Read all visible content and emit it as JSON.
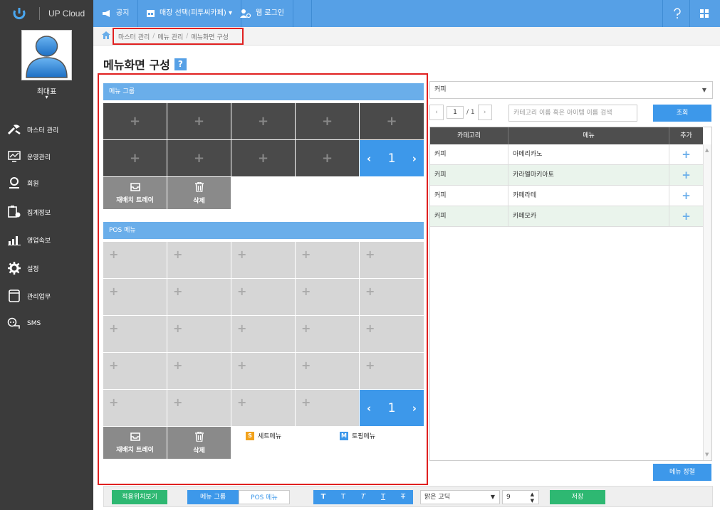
{
  "app": {
    "name": "UP Cloud"
  },
  "topnav": {
    "notice": "공지",
    "store_select": "매장 선택(피투씨카페) ▾",
    "login": "웹 로그인",
    "help_icon": "question-icon",
    "grid_icon": "grid-icon"
  },
  "user": {
    "name": "최대표",
    "caret": "▾"
  },
  "sidebar": {
    "items": [
      {
        "label": "마스터 관리",
        "icon": "tools-icon"
      },
      {
        "label": "운영관리",
        "icon": "chart-monitor-icon"
      },
      {
        "label": "회원",
        "icon": "user-icon"
      },
      {
        "label": "집계정보",
        "icon": "clipboard-icon"
      },
      {
        "label": "영업속보",
        "icon": "bar-chart-icon"
      },
      {
        "label": "설정",
        "icon": "gear-icon"
      },
      {
        "label": "관리업무",
        "icon": "notebook-icon"
      },
      {
        "label": "SMS",
        "icon": "sms-icon"
      }
    ]
  },
  "breadcrumb": {
    "items": [
      "마스터 관리",
      "메뉴 관리",
      "메뉴화면 구성"
    ],
    "sep": "/"
  },
  "page": {
    "title": "메뉴화면 구성",
    "help": "?"
  },
  "menu_group": {
    "header": "메뉴 그룹",
    "plus": "+",
    "page": "1",
    "prev": "‹",
    "next": "›",
    "tray_label": "재배치 트레이",
    "delete_label": "삭제"
  },
  "pos_menu": {
    "header": "POS 메뉴",
    "plus": "+",
    "page": "1",
    "prev": "‹",
    "next": "›",
    "tray_label": "재배치 트레이",
    "delete_label": "삭제",
    "legend_set": "세트메뉴",
    "legend_set_badge": "S",
    "legend_topping": "토핑메뉴",
    "legend_topping_badge": "M"
  },
  "right_panel": {
    "category_select": "커피",
    "pager_prev": "‹",
    "pager_next": "›",
    "pager_current": "1",
    "pager_total": "/ 1",
    "search_placeholder": "카테고리 이름 혹은 아이템 이름 검색",
    "search_button": "조회",
    "columns": [
      "카테고리",
      "메뉴",
      "추가"
    ],
    "rows": [
      {
        "category": "커피",
        "menu": "아메리카노",
        "add": "+"
      },
      {
        "category": "커피",
        "menu": "카라멜마키아토",
        "add": "+"
      },
      {
        "category": "커피",
        "menu": "카페라테",
        "add": "+"
      },
      {
        "category": "커피",
        "menu": "카페모카",
        "add": "+"
      }
    ],
    "sort_button": "메뉴 정렬"
  },
  "bottom": {
    "apply_view": "적용위치보기",
    "tab_group": "메뉴 그룹",
    "tab_pos": "POS 메뉴",
    "fmt": [
      "T",
      "T",
      "T",
      "T",
      "T"
    ],
    "font_select": "맑은 고딕",
    "size_select": "9",
    "save": "저장"
  },
  "colors": {
    "accent": "#3d98ea",
    "sidebar": "#3b3b3b",
    "highlight_border": "#e02020",
    "save": "#2eb872"
  }
}
